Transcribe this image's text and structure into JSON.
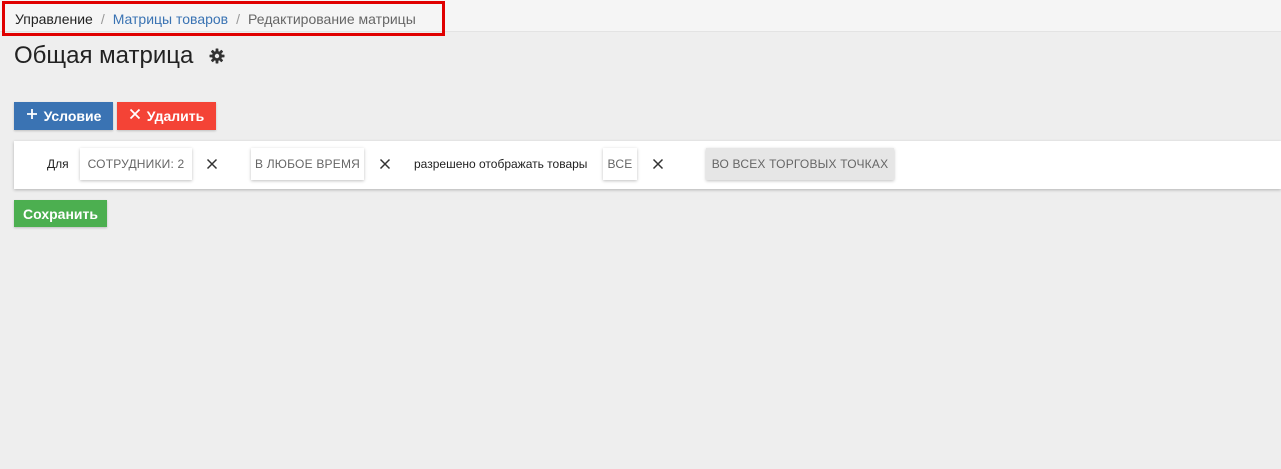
{
  "breadcrumb": {
    "root": "Управление",
    "separator": "/",
    "link": "Матрицы товаров",
    "current": "Редактирование матрицы"
  },
  "page": {
    "title": "Общая матрица"
  },
  "toolbar": {
    "add_label": "Условие",
    "delete_label": "Удалить",
    "save_label": "Сохранить"
  },
  "condition": {
    "for_label": "Для",
    "employees_chip": "СОТРУДНИКИ: 2",
    "time_chip": "В ЛЮБОЕ ВРЕМЯ",
    "allowed_text": "разрешено отображать товары",
    "goods_chip": "ВСЕ",
    "points_chip": "ВО ВСЕХ ТОРГОВЫХ ТОЧКАХ"
  },
  "colors": {
    "primary": "#3a73b3",
    "danger": "#f44336",
    "success": "#4caf50",
    "highlight": "#e00000"
  },
  "icons": {
    "settings": "gear-icon",
    "add": "plus-icon",
    "delete": "close-icon",
    "remove": "close-icon"
  }
}
